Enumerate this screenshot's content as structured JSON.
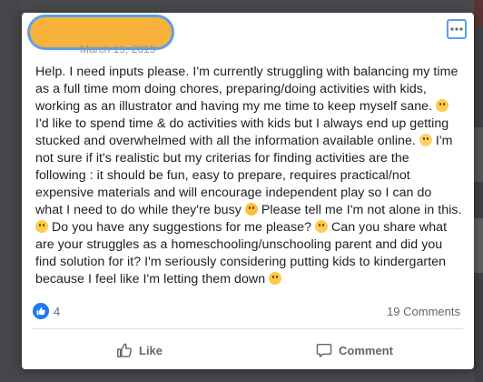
{
  "post": {
    "date": "March 19, 2019",
    "segments": [
      "Help. I need inputs please. I'm currently struggling with balancing my time as a full time mom doing chores, preparing/doing activities with kids, working as an illustrator and having my me time to keep myself sane. ",
      " I'd like to spend time & do activities with kids but I always end up getting stucked and overwhelmed with all the information available online. ",
      " I'm not sure if it's realistic but my criterias for finding activities are the following : it should be fun, easy to prepare, requires practical/not expensive materials and will encourage independent play so I can do what I need to do while they're busy ",
      " Please tell me I'm not alone in this. ",
      " Do you have any suggestions for me please? ",
      " Can you share what are your struggles as a homeschooling/unschooling parent and did you find solution for it? I'm seriously considering putting kids to kindergarten because I feel like I'm letting them down "
    ],
    "emojis": [
      "upside-down-face",
      "flushed-face",
      "rolling-laughing-face",
      "upside-down-face",
      "grinning-sweat-face",
      "pensive-face"
    ]
  },
  "stats": {
    "likes": "4",
    "comments": "19 Comments"
  },
  "actions": {
    "like_label": "Like",
    "comment_label": "Comment"
  },
  "colors": {
    "accent": "#2078f4",
    "name_redaction": "#f7b23b",
    "focus_ring": "#5aa0ea",
    "text": "#1c1e21",
    "muted": "#606770"
  }
}
